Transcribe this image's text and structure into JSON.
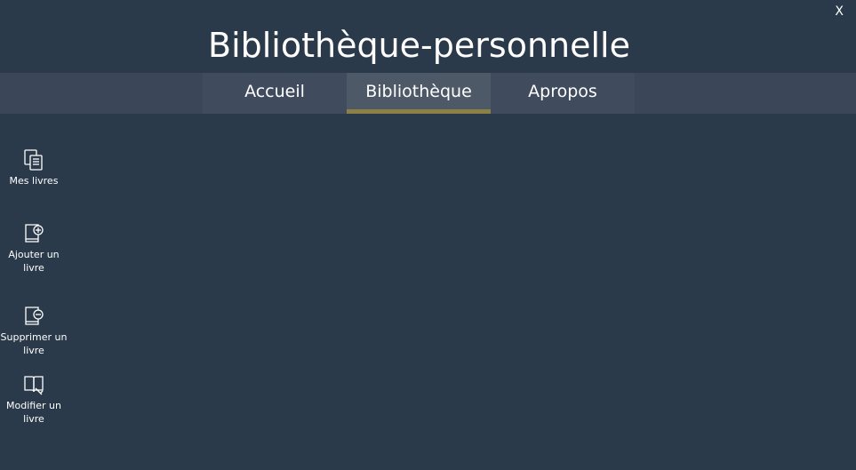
{
  "window": {
    "title": "Bibliothèque-personnelle",
    "close_label": "X"
  },
  "tabs": [
    {
      "label": "Accueil",
      "active": false
    },
    {
      "label": "Bibliothèque",
      "active": true
    },
    {
      "label": "Apropos",
      "active": false
    }
  ],
  "sidebar": {
    "items": [
      {
        "label": "Mes livres",
        "icon": "books-icon"
      },
      {
        "label": "Ajouter un livre",
        "icon": "book-add-icon"
      },
      {
        "label": "Supprimer un livre",
        "icon": "book-remove-icon"
      },
      {
        "label": "Modifier un livre",
        "icon": "book-edit-icon"
      }
    ]
  },
  "colors": {
    "background": "#2b3a4a",
    "tabbar": "#3b4758",
    "tab_active": "#4e5968",
    "tab_accent": "#8c8047"
  }
}
